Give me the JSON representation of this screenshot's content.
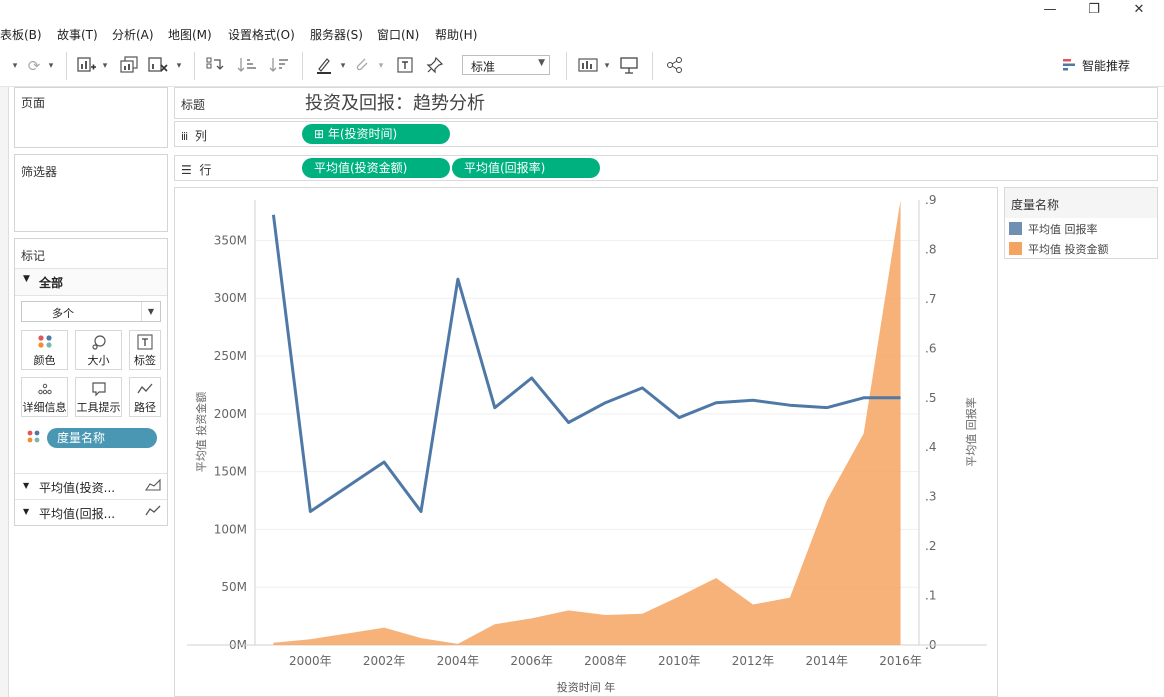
{
  "window": {
    "minimize": "—",
    "restore": "❐",
    "close": "✕"
  },
  "menu": [
    "表板(B)",
    "故事(T)",
    "分析(A)",
    "地图(M)",
    "设置格式(O)",
    "服务器(S)",
    "窗口(N)",
    "帮助(H)"
  ],
  "toolbar": {
    "fit_select": "标准",
    "smart_label": "智能推荐",
    "icons": [
      "undo-icon",
      "refresh-icon",
      "new-sheet-icon",
      "duplicate-sheet-icon",
      "clear-sheet-icon",
      "swap-icon",
      "sort-asc-icon",
      "sort-desc-icon",
      "highlight-icon",
      "group-icon",
      "label-icon",
      "pin-icon",
      "show-me-icon",
      "presentation-icon",
      "share-icon"
    ]
  },
  "left": {
    "pages_title": "页面",
    "filters_title": "筛选器",
    "marks_title": "标记",
    "marks_all": "全部",
    "mark_type": "多个",
    "buttons": [
      {
        "label": "颜色",
        "icon": "color-icon"
      },
      {
        "label": "大小",
        "icon": "size-icon"
      },
      {
        "label": "标签",
        "icon": "label-icon"
      },
      {
        "label": "详细信息",
        "icon": "detail-icon"
      },
      {
        "label": "工具提示",
        "icon": "tooltip-icon"
      },
      {
        "label": "路径",
        "icon": "path-icon"
      }
    ],
    "color_pill": "度量名称",
    "measure_cards": [
      "平均值(投资...",
      "平均值(回报..."
    ]
  },
  "shelves": {
    "title_label": "标题",
    "sheet_title": "投资及回报：趋势分析",
    "columns_label": "列",
    "columns_pill": "年(投资时间)",
    "rows_label": "行",
    "rows_pills": [
      "平均值(投资金额)",
      "平均值(回报率)"
    ]
  },
  "legend": {
    "title": "度量名称",
    "items": [
      {
        "name": "平均值 回报率",
        "color": "#4e79a7"
      },
      {
        "name": "平均值 投资金额",
        "color": "#f4a460"
      }
    ]
  },
  "chart_data": {
    "type": "line",
    "xlabel": "投资时间 年",
    "x": [
      1999,
      2000,
      2001,
      2002,
      2003,
      2004,
      2005,
      2006,
      2007,
      2008,
      2009,
      2010,
      2011,
      2012,
      2013,
      2014,
      2015,
      2016
    ],
    "x_ticks": [
      "2000年",
      "2002年",
      "2004年",
      "2006年",
      "2008年",
      "2010年",
      "2012年",
      "2014年",
      "2016年"
    ],
    "series": [
      {
        "name": "平均值 投资金额",
        "type": "area",
        "axis": "left",
        "color": "#f4a460",
        "values": [
          2,
          5,
          10,
          15,
          6,
          1,
          18,
          23,
          30,
          26,
          27,
          42,
          58,
          35,
          41,
          125,
          183,
          420
        ]
      },
      {
        "name": "平均值 回报率",
        "type": "line",
        "axis": "right",
        "color": "#4e79a7",
        "values": [
          0.87,
          0.27,
          0.32,
          0.37,
          0.27,
          0.74,
          0.48,
          0.54,
          0.45,
          0.49,
          0.52,
          0.46,
          0.49,
          0.495,
          0.485,
          0.48,
          0.5,
          0.5
        ]
      }
    ],
    "left_axis": {
      "label": "平均值 投资金额",
      "ylim": [
        0,
        385
      ],
      "ticks": [
        "0M",
        "50M",
        "100M",
        "150M",
        "200M",
        "250M",
        "300M",
        "350M"
      ]
    },
    "right_axis": {
      "label": "平均值 回报率",
      "ylim": [
        0,
        0.9
      ],
      "ticks": [
        ".0",
        ".1",
        ".2",
        ".3",
        ".4",
        ".5",
        ".6",
        ".7",
        ".8",
        ".9"
      ]
    },
    "grid": true
  }
}
